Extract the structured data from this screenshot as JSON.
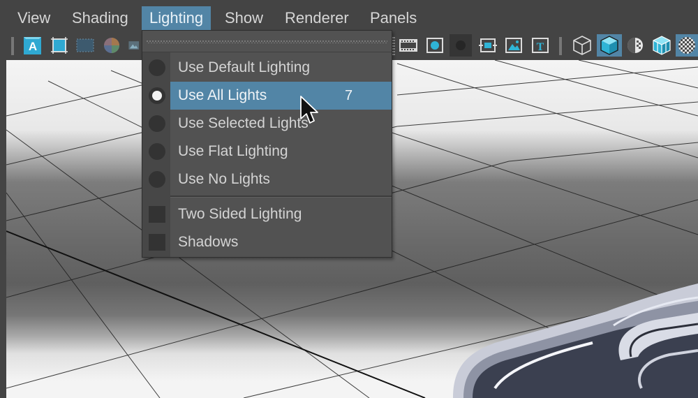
{
  "menubar": {
    "items": [
      {
        "label": "View"
      },
      {
        "label": "Shading"
      },
      {
        "label": "Lighting"
      },
      {
        "label": "Show"
      },
      {
        "label": "Renderer"
      },
      {
        "label": "Panels"
      }
    ],
    "active_index": 2
  },
  "toolbar": {
    "icons": [
      "camera-attributes-icon",
      "bookmark-icon",
      "grid-icon",
      "color-wheel-icon",
      "image-plane-icon",
      "film-gate-icon",
      "resolution-gate-icon",
      "gate-mask-icon",
      "field-chart-icon",
      "safe-action-icon",
      "safe-title-icon",
      "wireframe-icon",
      "smooth-shade-icon",
      "default-material-icon",
      "wireframe-on-shaded-icon",
      "xray-icon"
    ],
    "text_icon_glyph": "A",
    "title_icon_glyph": "T"
  },
  "lighting_menu": {
    "items": [
      {
        "label": "Use Default Lighting",
        "type": "radio",
        "checked": false
      },
      {
        "label": "Use All Lights",
        "type": "radio",
        "checked": true,
        "hotkey": "7",
        "highlighted": true
      },
      {
        "label": "Use Selected Lights",
        "type": "radio",
        "checked": false
      },
      {
        "label": "Use Flat Lighting",
        "type": "radio",
        "checked": false
      },
      {
        "label": "Use No Lights",
        "type": "radio",
        "checked": false
      },
      {
        "label": "Two Sided Lighting",
        "type": "checkbox",
        "checked": false
      },
      {
        "label": "Shadows",
        "type": "checkbox",
        "checked": false
      }
    ]
  },
  "colors": {
    "accent": "#5285a6",
    "background": "#444444",
    "menu_bg": "#525252",
    "icon_cyan": "#2fb4d6"
  }
}
